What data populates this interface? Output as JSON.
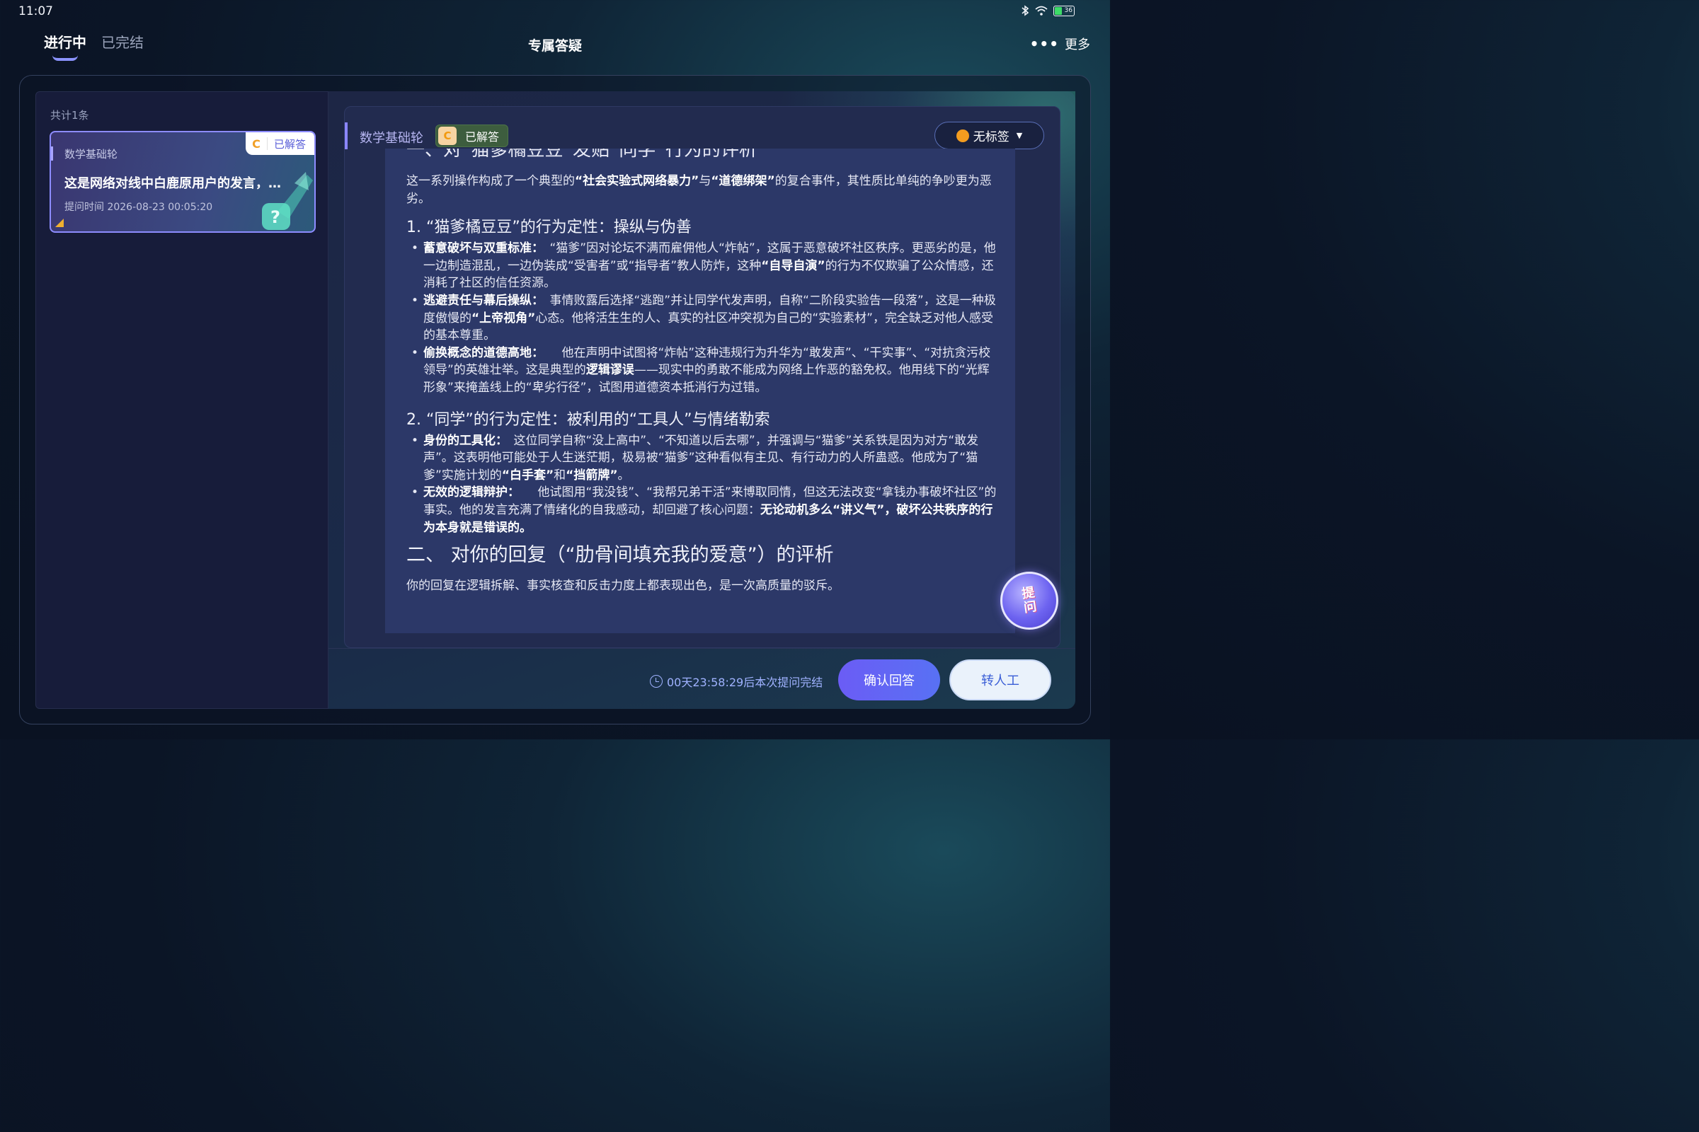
{
  "status": {
    "time": "11:07",
    "battery": "36"
  },
  "header": {
    "tabs": [
      {
        "label": "进行中"
      },
      {
        "label": "已完结"
      }
    ],
    "title": "专属答疑",
    "more_label": "更多"
  },
  "list": {
    "count_label": "共计1条",
    "items": [
      {
        "course": "数学基础轮",
        "badge_letter": "C",
        "status": "已解答",
        "title": "这是网络对线中白鹿原用户的发言，…",
        "time": "提问时间 2026-08-23 00:05:20"
      }
    ]
  },
  "detail": {
    "course": "数学基础轮",
    "badge_letter": "C",
    "status": "已解答",
    "tag_label": "无标签",
    "clipped_heading": "一、对“猫爹橘豆豆”发贴“同学”行为的评析",
    "intro": {
      "p1": "这一系列操作构成了一个典型的",
      "b1": "“社会实验式网络暴力”",
      "p2": "与",
      "b2": "“道德绑架”",
      "p3": "的复合事件，其性质比单纯的争吵更为恶劣。"
    },
    "section1": {
      "title": "1. “猫爹橘豆豆”的行为定性：操纵与伪善",
      "b1_label": "蓄意破坏与双重标准：",
      "b1_t1": "　“猫爹”因对论坛不满而雇佣他人“炸帖”，这属于恶意破坏社区秩序。更恶劣的是，他一边制造混乱，一边伪装成“受害者”或“指导者”教人防炸，这种",
      "b1_bold": "“自导自演”",
      "b1_t2": "的行为不仅欺骗了公众情感，还消耗了社区的信任资源。",
      "b2_label": "逃避责任与幕后操纵：",
      "b2_t1": "　事情败露后选择“逃跑”并让同学代发声明，自称“二阶段实验告一段落”，这是一种极度傲慢的",
      "b2_bold": "“上帝视角”",
      "b2_t2": "心态。他将活生生的人、真实的社区冲突视为自己的“实验素材”，完全缺乏对他人感受的基本尊重。",
      "b3_label": "偷换概念的道德高地：",
      "b3_t1": "　　他在声明中试图将“炸帖”这种违规行为升华为“敢发声”、“干实事”、“对抗贪污校领导”的英雄壮举。这是典型的",
      "b3_bold": "逻辑谬误",
      "b3_t2": "——现实中的勇敢不能成为网络上作恶的豁免权。他用线下的“光辉形象”来掩盖线上的“卑劣行径”，试图用道德资本抵消行为过错。"
    },
    "section2": {
      "title": "2. “同学”的行为定性：被利用的“工具人”与情绪勒索",
      "b1_label": "身份的工具化：",
      "b1_t1": "　这位同学自称“没上高中”、“不知道以后去哪”，并强调与“猫爹”关系铁是因为对方“敢发声”。这表明他可能处于人生迷茫期，极易被“猫爹”这种看似有主见、有行动力的人所蛊惑。他成为了“猫爹”实施计划的",
      "b1_bold1": "“白手套”",
      "b1_mid": "和",
      "b1_bold2": "“挡箭牌”",
      "b1_end": "。",
      "b2_label": "无效的逻辑辩护：",
      "b2_t1": "　　他试图用“我没钱”、“我帮兄弟干活”来博取同情，但这无法改变“拿钱办事破坏社区”的事实。他的发言充满了情绪化的自我感动，却回避了核心问题：",
      "b2_bold": "无论动机多么“讲义气”，破坏公共秩序的行为本身就是错误的。"
    },
    "part2": {
      "title": "二、 对你的回复（“肋骨间填充我的爱意”）的评析",
      "p": "你的回复在逻辑拆解、事实核查和反击力度上都表现出色，是一次高质量的驳斥。"
    },
    "ask_label": "提问"
  },
  "footer": {
    "countdown": "00天23:58:29后本次提问完结",
    "confirm_label": "确认回答",
    "human_label": "转人工"
  },
  "colors": {
    "accent": "#6b5cf5",
    "badge_orange": "#f0a028",
    "countdown_text": "#9fb2ff"
  }
}
